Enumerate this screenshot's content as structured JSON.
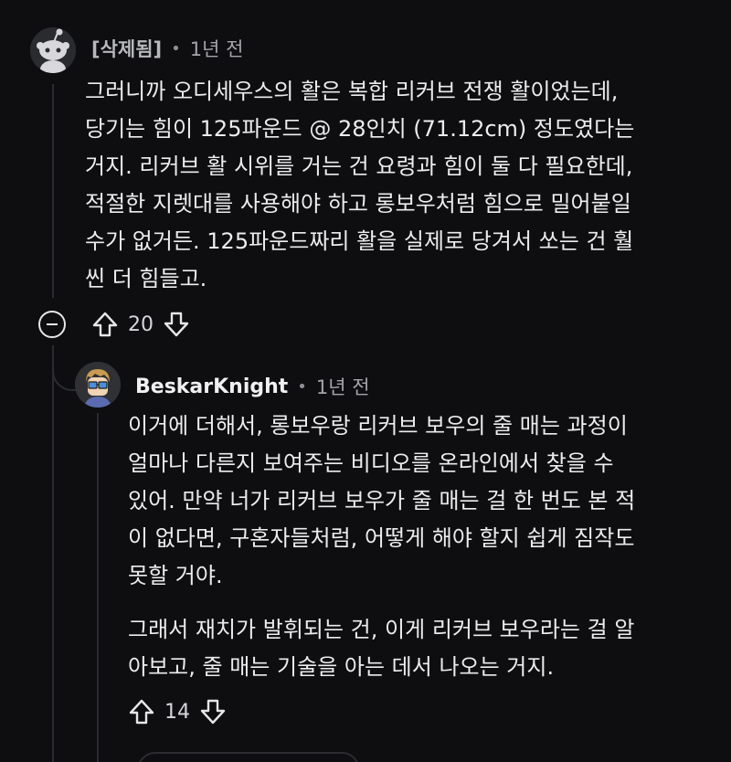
{
  "comment1": {
    "author": "[삭제됨]",
    "separator": "•",
    "time": "1년 전",
    "lines": [
      "그러니까 오디세우스의 활은 복합 리커브 전쟁 활이었는데,",
      "당기는 힘이 125파운드 @ 28인치 (71.12cm) 정도였다는",
      "거지. 리커브 활 시위를 거는 건 요령과 힘이 둘 다 필요한데,",
      "적절한 지렛대를 사용해야 하고 롱보우처럼 힘으로 밀어붙일",
      "수가 없거든. 125파운드짜리 활을 실제로 당겨서 쏘는 건 훨",
      "씬 더 힘들고."
    ],
    "votes": "20",
    "icons": {
      "collapse": "collapse-icon",
      "upvote": "upvote-icon",
      "downvote": "downvote-icon"
    }
  },
  "comment2": {
    "author": "BeskarKnight",
    "separator": "•",
    "time": "1년 전",
    "paragraph1": [
      "이거에 더해서, 롱보우랑 리커브 보우의 줄 매는 과정이",
      "얼마나 다른지 보여주는 비디오를 온라인에서 찾을 수",
      "있어. 만약 너가 리커브 보우가 줄 매는 걸 한 번도 본 적",
      "이 없다면, 구혼자들처럼, 어떻게 해야 할지 쉽게 짐작도",
      "못할 거야."
    ],
    "paragraph2": [
      "그래서 재치가 발휘되는 건, 이게 리커브 보우라는 걸 알",
      "아보고, 줄 매는 기술을 아는 데서 나오는 거지."
    ],
    "votes": "14"
  }
}
